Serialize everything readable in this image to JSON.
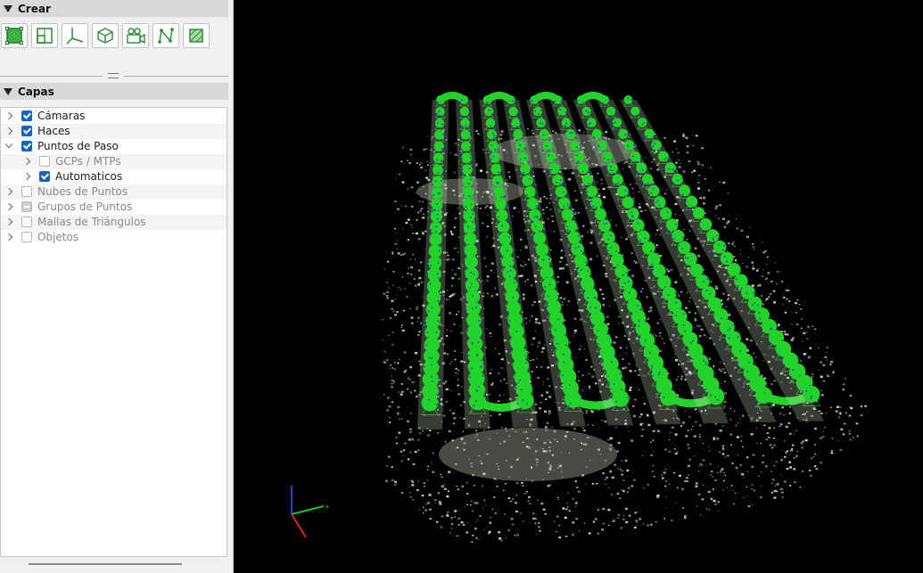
{
  "panels": {
    "create": {
      "title": "Crear",
      "tools": [
        {
          "name": "region-icon",
          "kind": "region"
        },
        {
          "name": "sub-region-icon",
          "kind": "subregion"
        },
        {
          "name": "axes-icon",
          "kind": "axes"
        },
        {
          "name": "box-icon",
          "kind": "box"
        },
        {
          "name": "camera-icon",
          "kind": "camera"
        },
        {
          "name": "polyline-icon",
          "kind": "polyline"
        },
        {
          "name": "crop-icon",
          "kind": "crop"
        }
      ]
    },
    "layers": {
      "title": "Capas",
      "items": [
        {
          "label": "Cámaras",
          "state": "checked",
          "expanded": false,
          "level": 0,
          "dim": false
        },
        {
          "label": "Haces",
          "state": "checked",
          "expanded": false,
          "level": 0,
          "dim": false
        },
        {
          "label": "Puntos de Paso",
          "state": "checked",
          "expanded": true,
          "level": 0,
          "dim": false
        },
        {
          "label": "GCPs / MTPs",
          "state": "unchecked",
          "expanded": false,
          "level": 1,
          "dim": true
        },
        {
          "label": "Automaticos",
          "state": "checked",
          "expanded": false,
          "level": 1,
          "dim": false
        },
        {
          "label": "Nubes de Puntos",
          "state": "unchecked",
          "expanded": false,
          "level": 0,
          "dim": true
        },
        {
          "label": "Grupos de Puntos",
          "state": "partial",
          "expanded": false,
          "level": 0,
          "dim": true
        },
        {
          "label": "Mallas de Triángulos",
          "state": "unchecked",
          "expanded": false,
          "level": 0,
          "dim": true
        },
        {
          "label": "Objetos",
          "state": "unchecked",
          "expanded": false,
          "level": 0,
          "dim": true
        }
      ]
    }
  },
  "viewport": {
    "background": "#000000",
    "colors": {
      "camera_green": "#22d42a",
      "camera_outline": "#3cf03c",
      "tie_points_blue": "#1e3cc8",
      "point_cloud": "#e4e0d2",
      "axis_x": "#e02020",
      "axis_y": "#20c020",
      "axis_z": "#2040e0"
    },
    "flight_strips": 9
  }
}
